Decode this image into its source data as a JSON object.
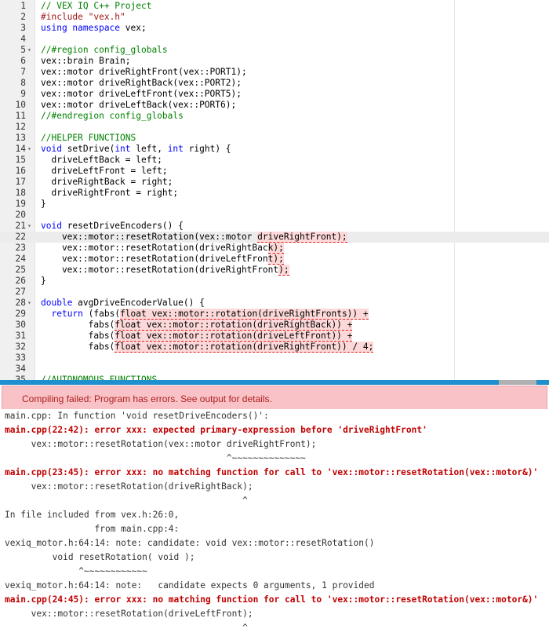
{
  "editor": {
    "lines": [
      {
        "n": "1",
        "fold": "",
        "segs": [
          {
            "t": "// VEX IQ C++ Project",
            "c": "c-comment"
          }
        ]
      },
      {
        "n": "2",
        "fold": "",
        "segs": [
          {
            "t": "#include ",
            "c": "c-pre"
          },
          {
            "t": "\"vex.h\"",
            "c": "c-pre"
          }
        ]
      },
      {
        "n": "3",
        "fold": "",
        "segs": [
          {
            "t": "using namespace",
            "c": "c-kw"
          },
          {
            "t": " vex;",
            "c": ""
          }
        ]
      },
      {
        "n": "4",
        "fold": "",
        "segs": []
      },
      {
        "n": "5",
        "fold": "▾",
        "segs": [
          {
            "t": "//#region config_globals",
            "c": "c-comment"
          }
        ]
      },
      {
        "n": "6",
        "fold": "",
        "segs": [
          {
            "t": "vex::brain Brain;",
            "c": ""
          }
        ]
      },
      {
        "n": "7",
        "fold": "",
        "segs": [
          {
            "t": "vex::motor driveRightFront(vex::PORT1);",
            "c": ""
          }
        ]
      },
      {
        "n": "8",
        "fold": "",
        "segs": [
          {
            "t": "vex::motor driveRightBack(vex::PORT2);",
            "c": ""
          }
        ]
      },
      {
        "n": "9",
        "fold": "",
        "segs": [
          {
            "t": "vex::motor driveLeftFront(vex::PORT5);",
            "c": ""
          }
        ]
      },
      {
        "n": "10",
        "fold": "",
        "segs": [
          {
            "t": "vex::motor driveLeftBack(vex::PORT6);",
            "c": ""
          }
        ]
      },
      {
        "n": "11",
        "fold": "",
        "segs": [
          {
            "t": "//#endregion config_globals",
            "c": "c-comment"
          }
        ]
      },
      {
        "n": "12",
        "fold": "",
        "segs": []
      },
      {
        "n": "13",
        "fold": "",
        "segs": [
          {
            "t": "//HELPER FUNCTIONS",
            "c": "c-comment"
          }
        ]
      },
      {
        "n": "14",
        "fold": "▾",
        "segs": [
          {
            "t": "void",
            "c": "c-kw"
          },
          {
            "t": " setDrive(",
            "c": ""
          },
          {
            "t": "int",
            "c": "c-kw"
          },
          {
            "t": " left, ",
            "c": ""
          },
          {
            "t": "int",
            "c": "c-kw"
          },
          {
            "t": " right) {",
            "c": ""
          }
        ]
      },
      {
        "n": "15",
        "fold": "",
        "segs": [
          {
            "t": "  driveLeftBack = left;",
            "c": ""
          }
        ]
      },
      {
        "n": "16",
        "fold": "",
        "segs": [
          {
            "t": "  driveLeftFront = left;",
            "c": ""
          }
        ]
      },
      {
        "n": "17",
        "fold": "",
        "segs": [
          {
            "t": "  driveRightBack = right;",
            "c": ""
          }
        ]
      },
      {
        "n": "18",
        "fold": "",
        "segs": [
          {
            "t": "  driveRightFront = right;",
            "c": ""
          }
        ]
      },
      {
        "n": "19",
        "fold": "",
        "segs": [
          {
            "t": "}",
            "c": ""
          }
        ]
      },
      {
        "n": "20",
        "fold": "",
        "segs": []
      },
      {
        "n": "21",
        "fold": "▾",
        "segs": [
          {
            "t": "void",
            "c": "c-kw"
          },
          {
            "t": " resetDriveEncoders() {",
            "c": ""
          }
        ]
      },
      {
        "n": "22",
        "fold": "",
        "active": true,
        "segs": [
          {
            "t": "    vex::motor::resetRotation(vex::motor ",
            "c": ""
          },
          {
            "t": "driveRightFront);",
            "c": "err"
          }
        ]
      },
      {
        "n": "23",
        "fold": "",
        "segs": [
          {
            "t": "    vex::motor::resetRotation(driveRightBac",
            "c": ""
          },
          {
            "t": "k);",
            "c": "err"
          }
        ]
      },
      {
        "n": "24",
        "fold": "",
        "segs": [
          {
            "t": "    vex::motor::resetRotation(driveLeftFron",
            "c": ""
          },
          {
            "t": "t);",
            "c": "err"
          }
        ]
      },
      {
        "n": "25",
        "fold": "",
        "segs": [
          {
            "t": "    vex::motor::resetRotation(driveRightFront",
            "c": ""
          },
          {
            "t": ");",
            "c": "err"
          }
        ]
      },
      {
        "n": "26",
        "fold": "",
        "segs": [
          {
            "t": "}",
            "c": ""
          }
        ]
      },
      {
        "n": "27",
        "fold": "",
        "segs": []
      },
      {
        "n": "28",
        "fold": "▾",
        "segs": [
          {
            "t": "double",
            "c": "c-kw"
          },
          {
            "t": " avgDriveEncoderValue() {",
            "c": ""
          }
        ]
      },
      {
        "n": "29",
        "fold": "",
        "segs": [
          {
            "t": "  ",
            "c": ""
          },
          {
            "t": "return",
            "c": "c-kw"
          },
          {
            "t": " (fabs(",
            "c": ""
          },
          {
            "t": "float vex::motor::rotation(driveRightFronts)) +",
            "c": "err"
          }
        ]
      },
      {
        "n": "30",
        "fold": "",
        "segs": [
          {
            "t": "         fabs(",
            "c": ""
          },
          {
            "t": "float vex::motor::rotation(driveRightBack)) +",
            "c": "err"
          }
        ]
      },
      {
        "n": "31",
        "fold": "",
        "segs": [
          {
            "t": "         fabs(",
            "c": ""
          },
          {
            "t": "float vex::motor::rotation(driveLeftFront)) +",
            "c": "err"
          }
        ]
      },
      {
        "n": "32",
        "fold": "",
        "segs": [
          {
            "t": "         fabs(",
            "c": ""
          },
          {
            "t": "float vex::motor::rotation(driveRightFront)) / 4;",
            "c": "err"
          }
        ]
      },
      {
        "n": "33",
        "fold": "",
        "segs": []
      },
      {
        "n": "34",
        "fold": "",
        "segs": []
      },
      {
        "n": "35",
        "fold": "",
        "segs": [
          {
            "t": "//AUTONOMOUS FUNCTIONS",
            "c": "c-comment"
          }
        ]
      }
    ]
  },
  "banner": {
    "message": "Compiling failed: Program has errors. See output for details."
  },
  "output": {
    "lines": [
      {
        "t": "main.cpp: In function 'void resetDriveEncoders()':",
        "type": "normal"
      },
      {
        "t": "main.cpp(22:42): error xxx: expected primary-expression before 'driveRightFront'",
        "type": "error"
      },
      {
        "t": "     vex::motor::resetRotation(vex::motor driveRightFront);",
        "type": "normal"
      },
      {
        "t": "                                          ^~~~~~~~~~~~~~~",
        "type": "normal"
      },
      {
        "t": "main.cpp(23:45): error xxx: no matching function for call to 'vex::motor::resetRotation(vex::motor&)'",
        "type": "error"
      },
      {
        "t": "     vex::motor::resetRotation(driveRightBack);",
        "type": "normal"
      },
      {
        "t": "                                             ^",
        "type": "normal"
      },
      {
        "t": "In file included from vex.h:26:0,",
        "type": "normal"
      },
      {
        "t": "                 from main.cpp:4:",
        "type": "normal"
      },
      {
        "t": "vexiq_motor.h:64:14: note: candidate: void vex::motor::resetRotation()",
        "type": "normal"
      },
      {
        "t": "         void resetRotation( void );",
        "type": "normal"
      },
      {
        "t": "              ^~~~~~~~~~~~~",
        "type": "normal"
      },
      {
        "t": "vexiq_motor.h:64:14: note:   candidate expects 0 arguments, 1 provided",
        "type": "normal"
      },
      {
        "t": "main.cpp(24:45): error xxx: no matching function for call to 'vex::motor::resetRotation(vex::motor&)'",
        "type": "error"
      },
      {
        "t": "     vex::motor::resetRotation(driveLeftFront);",
        "type": "normal"
      },
      {
        "t": "                                             ^",
        "type": "normal"
      }
    ]
  },
  "colors": {
    "error_text": "#c00000",
    "banner_bg": "#f8c2c6",
    "scrollbar": "#1e8fcf",
    "comment": "#008000",
    "keyword": "#0000ff"
  }
}
